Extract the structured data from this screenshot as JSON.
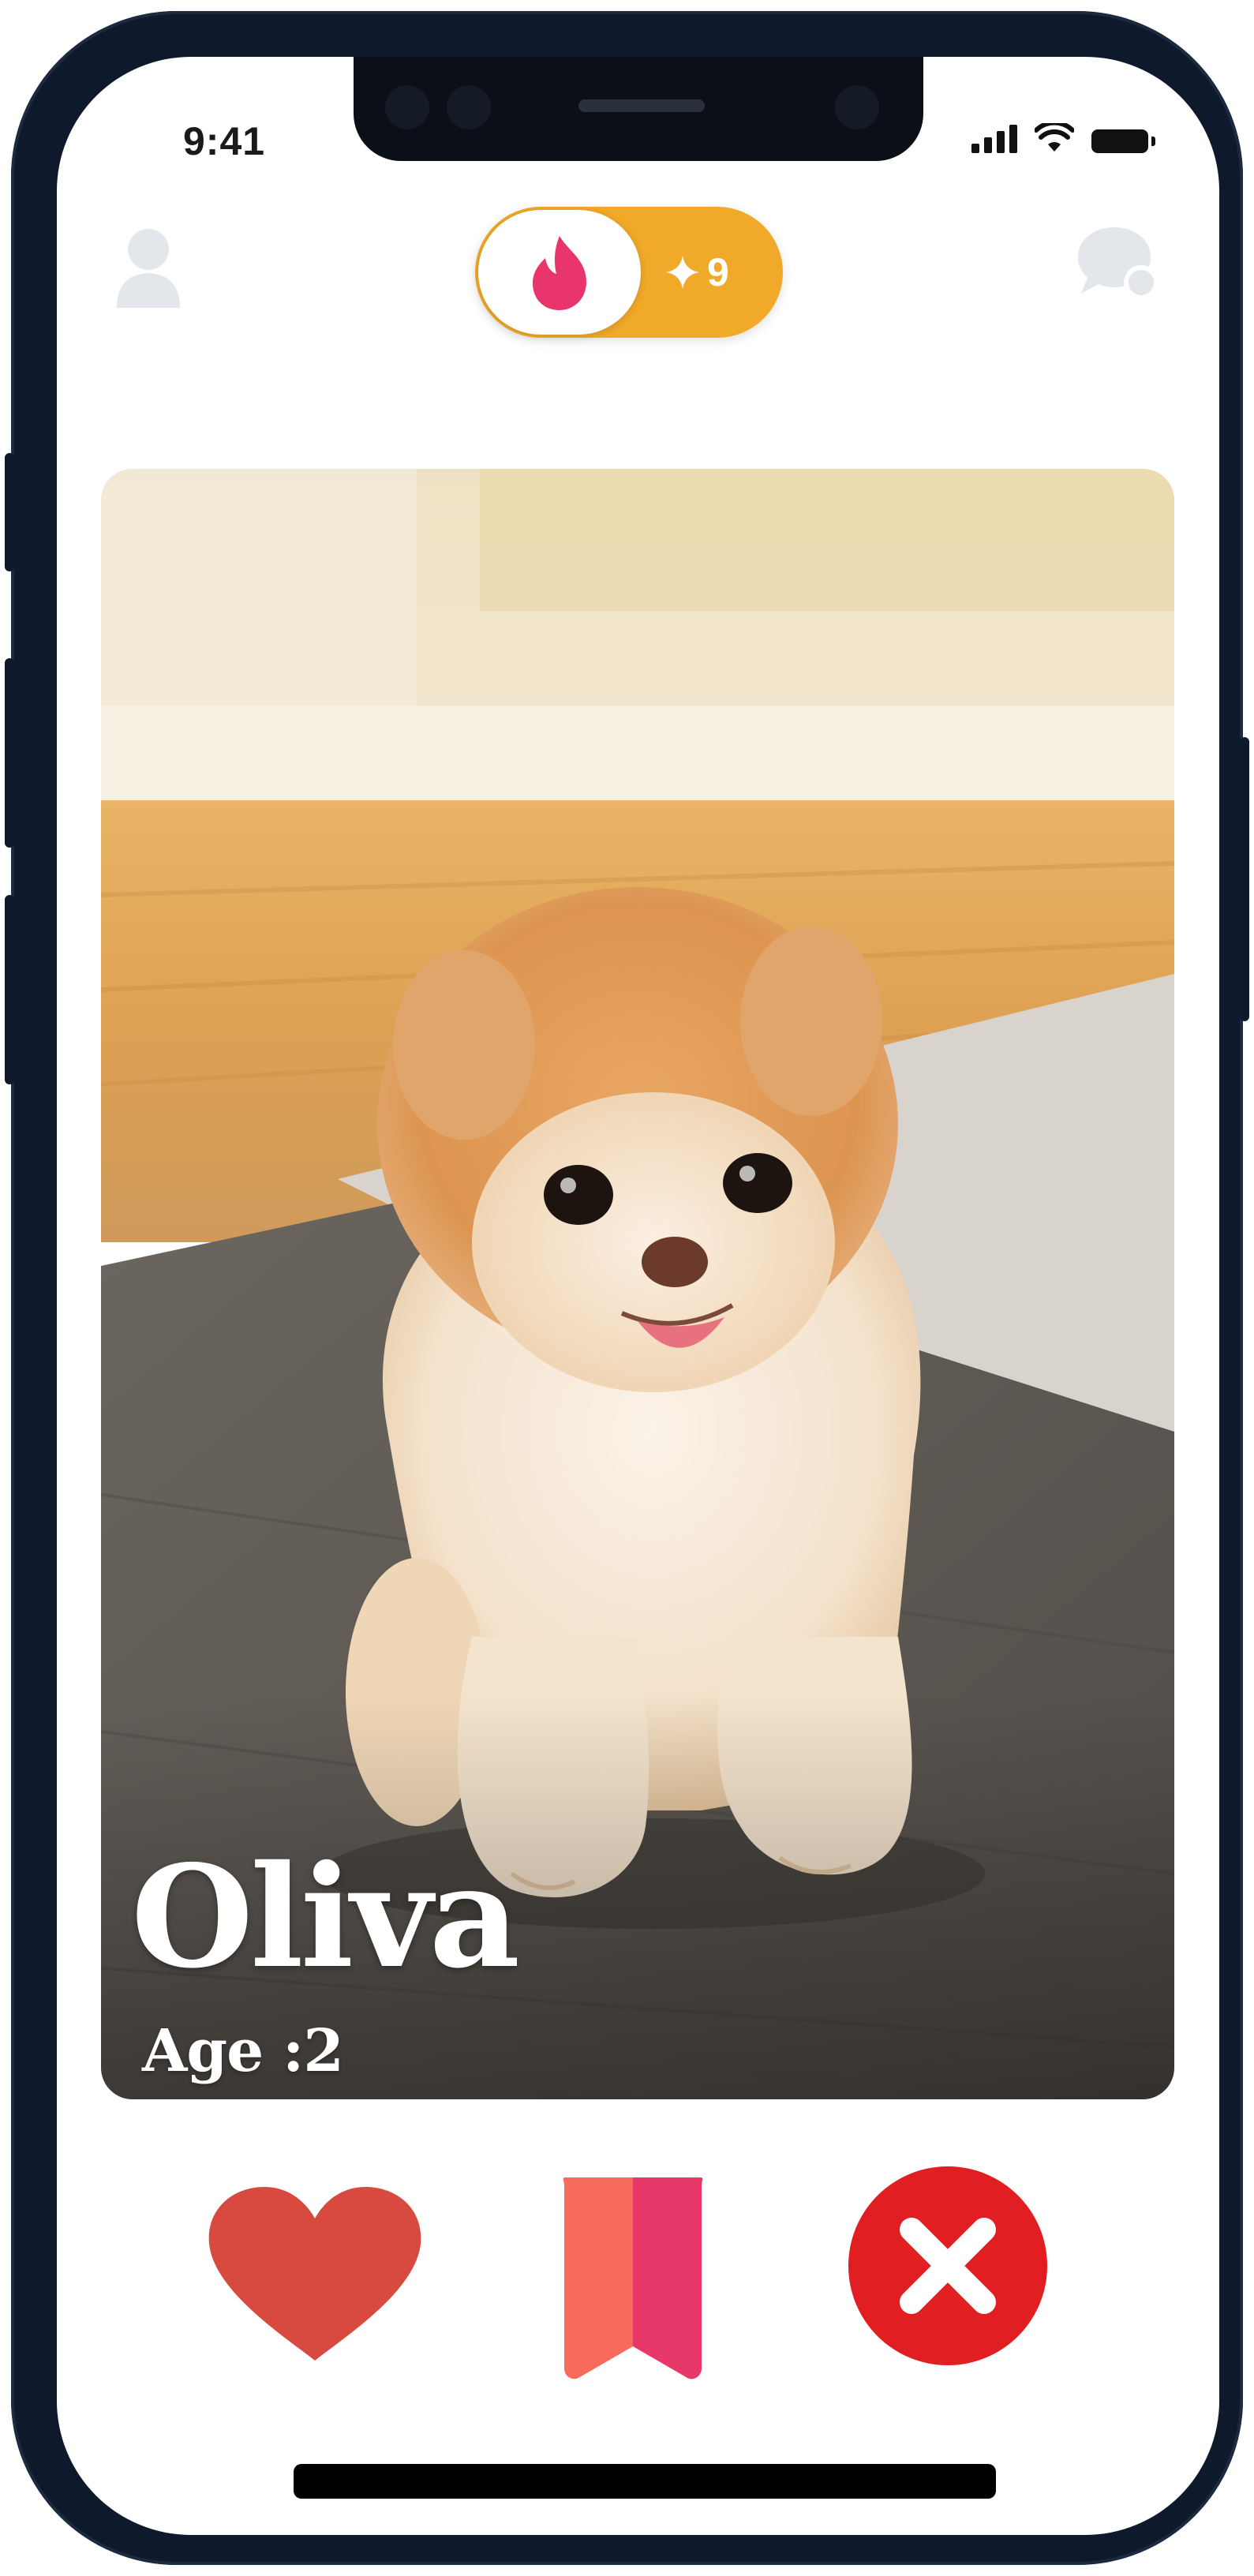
{
  "status_bar": {
    "time": "9:41",
    "signal_icon": "signal-bars-icon",
    "wifi_icon": "wifi-icon",
    "battery_icon": "battery-icon"
  },
  "top_bar": {
    "profile_icon": "user-icon",
    "messages_icon": "chat-bubbles-icon",
    "mode_toggle": {
      "active_icon": "flame-icon",
      "badge_icon": "sparkle-icon",
      "count": "9"
    }
  },
  "profile_card": {
    "photo": "pomeranian-puppy-photo",
    "name": "Oliva",
    "age_label": "Age :2"
  },
  "actions": {
    "like": "heart-icon",
    "save": "bookmark-icon",
    "dismiss": "close-icon"
  },
  "colors": {
    "like": "#d84a3f",
    "bookmark_left": "#f86a5c",
    "bookmark_right": "#e8386a",
    "dismiss": "#e11f22",
    "toggle_accent": "#f0a928",
    "flame": "#e8356b",
    "phone_frame": "#0e1a2b"
  }
}
